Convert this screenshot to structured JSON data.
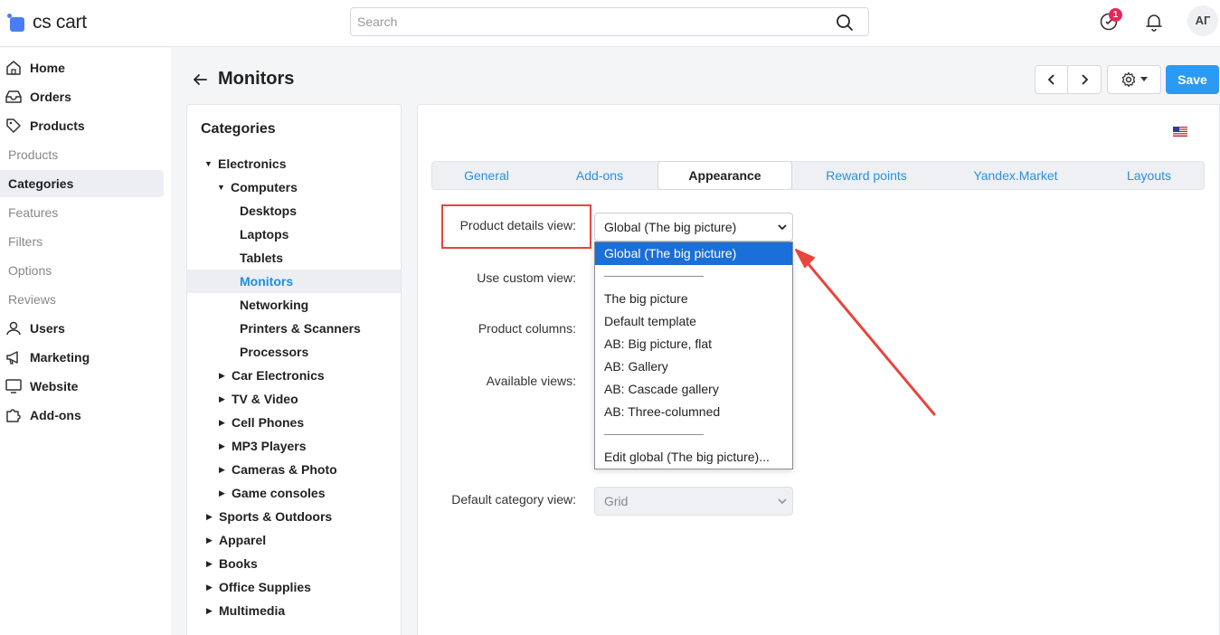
{
  "header": {
    "logo_text": "cs cart",
    "search_placeholder": "Search",
    "notification_count": "1",
    "avatar_initials": "АГ"
  },
  "sidebar": {
    "items": [
      {
        "label": "Home",
        "type": "main",
        "icon": "home-icon"
      },
      {
        "label": "Orders",
        "type": "main",
        "icon": "orders-icon"
      },
      {
        "label": "Products",
        "type": "main",
        "icon": "tag-icon"
      },
      {
        "label": "Products",
        "type": "sub"
      },
      {
        "label": "Categories",
        "type": "sub",
        "active": true
      },
      {
        "label": "Features",
        "type": "sub"
      },
      {
        "label": "Filters",
        "type": "sub"
      },
      {
        "label": "Options",
        "type": "sub"
      },
      {
        "label": "Reviews",
        "type": "sub"
      },
      {
        "label": "Users",
        "type": "main",
        "icon": "user-icon"
      },
      {
        "label": "Marketing",
        "type": "main",
        "icon": "megaphone-icon"
      },
      {
        "label": "Website",
        "type": "main",
        "icon": "monitor-icon"
      },
      {
        "label": "Add-ons",
        "type": "main",
        "icon": "puzzle-icon"
      }
    ]
  },
  "page": {
    "title": "Monitors",
    "save_label": "Save"
  },
  "categories": {
    "title": "Categories",
    "tree": [
      {
        "label": "Electronics",
        "level": 0,
        "caret": "down"
      },
      {
        "label": "Computers",
        "level": 1,
        "caret": "down"
      },
      {
        "label": "Desktops",
        "level": 2,
        "caret": ""
      },
      {
        "label": "Laptops",
        "level": 2,
        "caret": ""
      },
      {
        "label": "Tablets",
        "level": 2,
        "caret": ""
      },
      {
        "label": "Monitors",
        "level": 2,
        "caret": "",
        "active": true
      },
      {
        "label": "Networking",
        "level": 2,
        "caret": ""
      },
      {
        "label": "Printers & Scanners",
        "level": 2,
        "caret": ""
      },
      {
        "label": "Processors",
        "level": 2,
        "caret": ""
      },
      {
        "label": "Car Electronics",
        "level": 1,
        "caret": "right"
      },
      {
        "label": "TV & Video",
        "level": 1,
        "caret": "right"
      },
      {
        "label": "Cell Phones",
        "level": 1,
        "caret": "right"
      },
      {
        "label": "MP3 Players",
        "level": 1,
        "caret": "right"
      },
      {
        "label": "Cameras & Photo",
        "level": 1,
        "caret": "right"
      },
      {
        "label": "Game consoles",
        "level": 1,
        "caret": "right"
      },
      {
        "label": "Sports & Outdoors",
        "level": 0,
        "caret": "right"
      },
      {
        "label": "Apparel",
        "level": 0,
        "caret": "right"
      },
      {
        "label": "Books",
        "level": 0,
        "caret": "right"
      },
      {
        "label": "Office Supplies",
        "level": 0,
        "caret": "right"
      },
      {
        "label": "Multimedia",
        "level": 0,
        "caret": "right"
      }
    ]
  },
  "tabs": [
    {
      "label": "General"
    },
    {
      "label": "Add-ons"
    },
    {
      "label": "Appearance",
      "active": true
    },
    {
      "label": "Reward points"
    },
    {
      "label": "Yandex.Market"
    },
    {
      "label": "Layouts"
    }
  ],
  "form": {
    "product_details_view_label": "Product details view:",
    "product_details_view_value": "Global (The big picture)",
    "use_custom_view_label": "Use custom view:",
    "product_columns_label": "Product columns:",
    "available_views_label": "Available views:",
    "default_category_view_label": "Default category view:",
    "default_category_view_value": "Grid"
  },
  "dropdown": {
    "options": [
      {
        "label": "Global (The big picture)",
        "selected": true
      },
      {
        "label": "———————————"
      },
      {
        "label": "The big picture"
      },
      {
        "label": "Default template"
      },
      {
        "label": "AB: Big picture, flat"
      },
      {
        "label": "AB: Gallery"
      },
      {
        "label": "AB: Cascade gallery"
      },
      {
        "label": "AB: Three-columned"
      },
      {
        "label": ""
      },
      {
        "label": "———————————"
      },
      {
        "label": "Edit global (The big picture)..."
      }
    ]
  },
  "colors": {
    "accent": "#2b9af3",
    "link": "#2b8fe0",
    "selected_option": "#1a6fd8",
    "annotation": "#e8453c"
  }
}
